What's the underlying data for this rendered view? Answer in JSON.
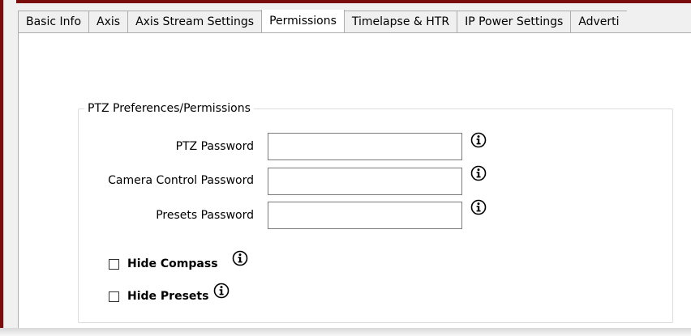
{
  "tabs": [
    {
      "label": "Basic Info"
    },
    {
      "label": "Axis"
    },
    {
      "label": "Axis Stream Settings"
    },
    {
      "label": "Permissions",
      "active": true
    },
    {
      "label": "Timelapse & HTR"
    },
    {
      "label": "IP Power Settings"
    },
    {
      "label": "Adverti"
    }
  ],
  "group": {
    "title": "PTZ Preferences/Permissions"
  },
  "fields": {
    "ptz_password": {
      "label": "PTZ Password",
      "value": ""
    },
    "camera_control_password": {
      "label": "Camera Control Password",
      "value": ""
    },
    "presets_password": {
      "label": "Presets Password",
      "value": ""
    }
  },
  "checkboxes": {
    "hide_compass": {
      "label": "Hide Compass",
      "checked": false
    },
    "hide_presets": {
      "label": "Hide Presets",
      "checked": false
    }
  },
  "colors": {
    "frame_accent": "#7a0c0c",
    "panel_bg": "#ffffff",
    "window_bg": "#f0f0f0"
  },
  "icons": {
    "info": "info-icon"
  }
}
